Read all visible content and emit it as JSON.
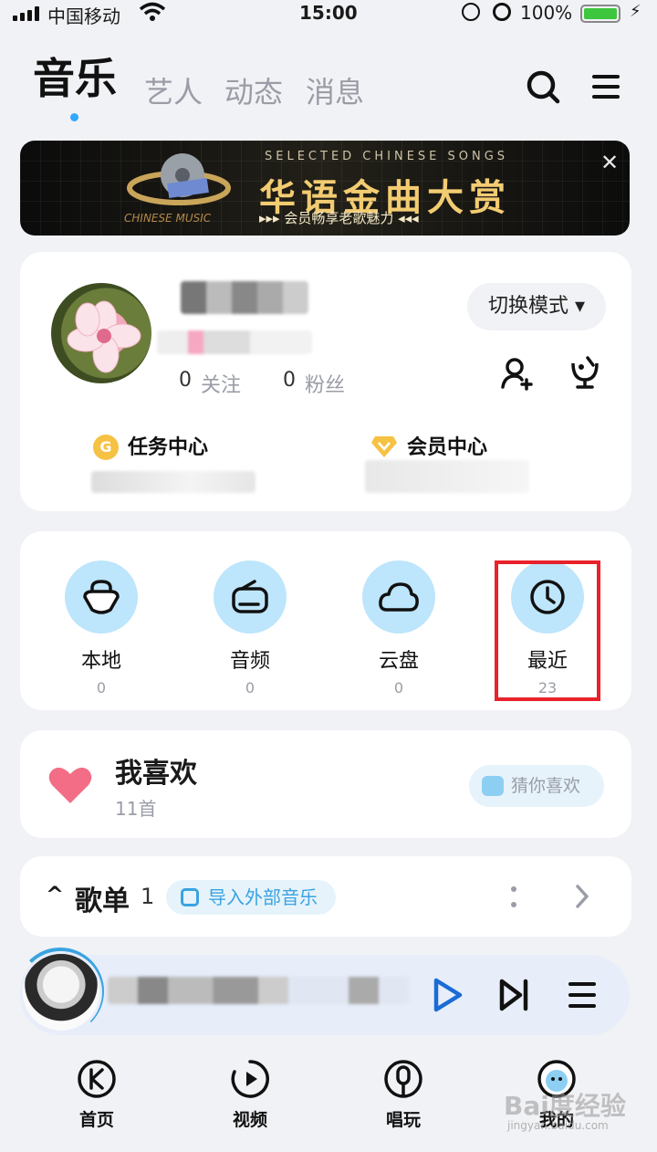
{
  "status_bar": {
    "carrier": "中国移动",
    "time": "15:00",
    "battery": "100%"
  },
  "top_nav": {
    "tabs": [
      {
        "label": "音乐",
        "active": true
      },
      {
        "label": "艺人",
        "active": false
      },
      {
        "label": "动态",
        "active": false
      },
      {
        "label": "消息",
        "active": false
      }
    ]
  },
  "banner": {
    "en": "SELECTED CHINESE SONGS",
    "zh": "华语金曲大赏",
    "sub": "▸▸▸ 会员畅享老歌魅力 ◂◂◂",
    "badge": "CHINESE MUSIC",
    "close": "✕"
  },
  "profile": {
    "switch_mode": "切换模式 ▾",
    "following_count": "0",
    "following_label": "关注",
    "fans_count": "0",
    "fans_label": "粉丝",
    "task_center": "任务中心",
    "task_coin": "G",
    "vip_center": "会员中心"
  },
  "quick_access": [
    {
      "label": "本地",
      "count": "0",
      "icon": "local-icon"
    },
    {
      "label": "音频",
      "count": "0",
      "icon": "audio-icon"
    },
    {
      "label": "云盘",
      "count": "0",
      "icon": "cloud-icon"
    },
    {
      "label": "最近",
      "count": "23",
      "icon": "clock-icon"
    }
  ],
  "favorites": {
    "title": "我喜欢",
    "count": "11首",
    "guess": "猜你喜欢"
  },
  "playlist": {
    "arrow": "^",
    "title": "歌单",
    "count": "1",
    "import": "导入外部音乐"
  },
  "bottom_nav": [
    {
      "label": "首页",
      "icon": "home-k-icon"
    },
    {
      "label": "视频",
      "icon": "video-play-icon"
    },
    {
      "label": "唱玩",
      "icon": "mic-icon"
    },
    {
      "label": "我的",
      "icon": "me-icon"
    }
  ],
  "watermark": {
    "text": "Bai度经验",
    "url": "jingyan.baidu.com"
  },
  "colors": {
    "accent": "#31a7ff",
    "highlight": "#e8212a",
    "heart": "#f26d85",
    "circle_bg": "#bde5fb"
  }
}
